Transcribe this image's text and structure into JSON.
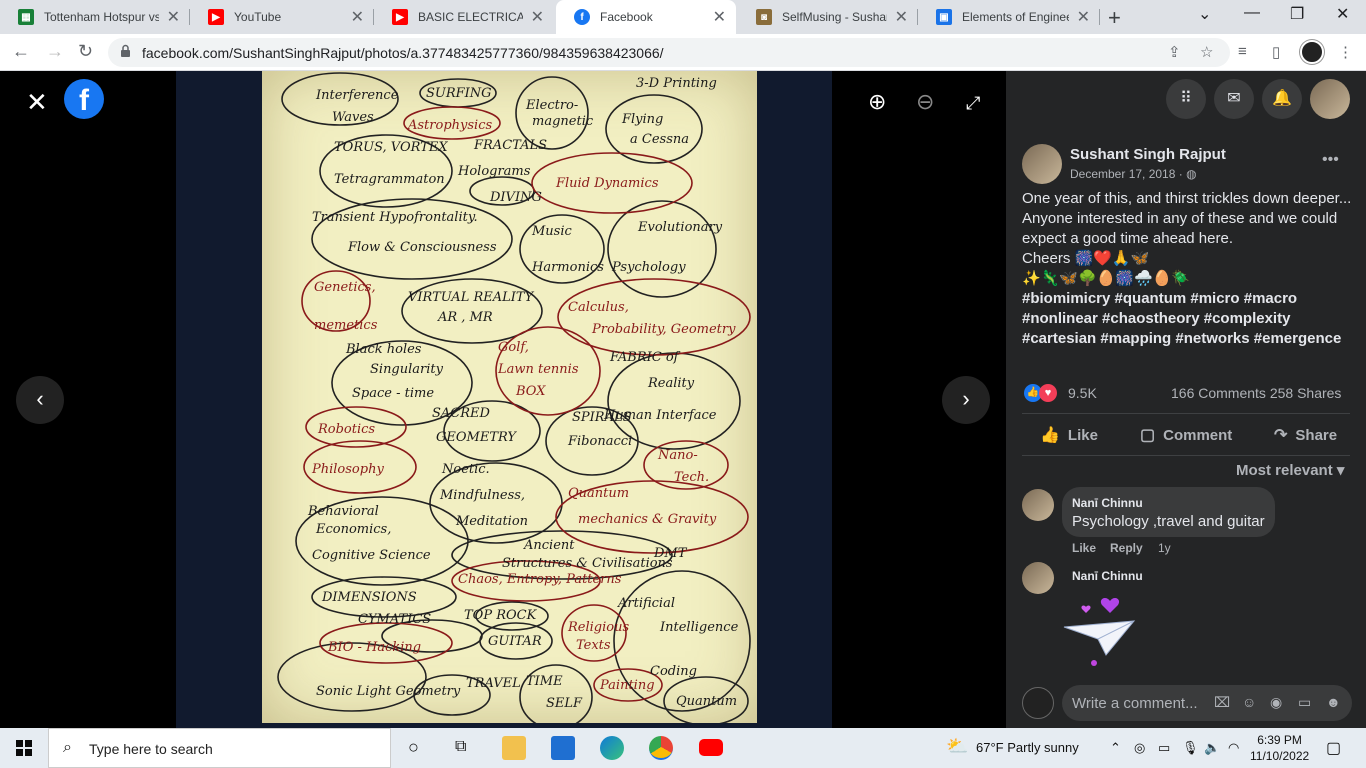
{
  "browser": {
    "tabs": [
      {
        "title": "Tottenham Hotspur vs",
        "icon": "sheets-icon",
        "color": "#188038"
      },
      {
        "title": "YouTube",
        "icon": "youtube-icon",
        "color": "#ff0000"
      },
      {
        "title": "BASIC ELECTRICAL & I",
        "icon": "youtube-icon",
        "color": "#ff0000"
      },
      {
        "title": "Facebook",
        "icon": "facebook-icon",
        "color": "#1877f2",
        "active": true
      },
      {
        "title": "SelfMusing - Sushant",
        "icon": "photo-icon",
        "color": "#8a6d3b"
      },
      {
        "title": "Elements of Engineeri",
        "icon": "classroom-icon",
        "color": "#1a73e8"
      }
    ],
    "new_tab": "+",
    "url": "facebook.com/SushantSinghRajput/photos/a.377483425777360/984359638423066/"
  },
  "viewer": {
    "close": "✕",
    "logo": "f",
    "zoom_in": "⊕",
    "zoom_out": "⊖",
    "fullscreen": "⤢",
    "prev": "‹",
    "next": "›"
  },
  "post": {
    "author": "Sushant Singh Rajput",
    "date": "December 17, 2018 · ",
    "more": "•••",
    "caption_lines": [
      "One year of this, and thirst trickles down deeper...",
      "Anyone interested in any of these and we could",
      "expect a good time ahead here.",
      "Cheers 🎆❤️🙏🦋",
      "✨🦎🦋🌳🥚🎆🌧️🥚🪲",
      "#biomimicry #quantum #micro #macro",
      "#nonlinear #chaostheory #complexity",
      "#cartesian #mapping #networks #emergence"
    ],
    "reactions_count": "9.5K",
    "comments_shares": "166 Comments  258 Shares",
    "actions": {
      "like": "Like",
      "comment": "Comment",
      "share": "Share"
    },
    "sort": "Most relevant",
    "comments": [
      {
        "name": "Nanī Chinnu",
        "text": "Psychology ,travel and guitar",
        "like": "Like",
        "reply": "Reply",
        "time": "1y"
      },
      {
        "name": "Nanī Chinnu"
      }
    ],
    "composer_placeholder": "Write a comment..."
  },
  "taskbar": {
    "search_placeholder": "Type here to search",
    "weather": "67°F  Partly sunny",
    "time": "6:39 PM",
    "date": "11/10/2022"
  }
}
